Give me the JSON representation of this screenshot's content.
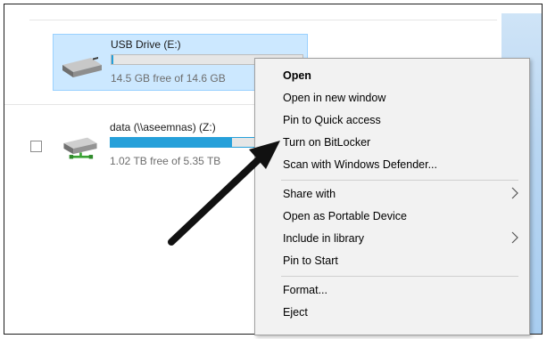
{
  "drives": {
    "usb": {
      "name": "USB Drive (E:)",
      "free_text": "14.5 GB free of 14.6 GB",
      "used_fraction": 0.01
    },
    "network": {
      "name": "data (\\\\aseemnas) (Z:)",
      "free_text": "1.02 TB free of 5.35 TB",
      "used_fraction": 0.81
    }
  },
  "context_menu": {
    "open": "Open",
    "open_new_window": "Open in new window",
    "pin_quick_access": "Pin to Quick access",
    "turn_on_bitlocker": "Turn on BitLocker",
    "scan_defender": "Scan with Windows Defender...",
    "share_with": "Share with",
    "open_portable": "Open as Portable Device",
    "include_library": "Include in library",
    "pin_start": "Pin to Start",
    "format": "Format...",
    "eject": "Eject"
  },
  "colors": {
    "selection": "#cce8ff",
    "bar_fill": "#26a0da",
    "menu_bg": "#f2f2f2"
  },
  "icons": [
    "usb-drive-icon",
    "network-drive-icon",
    "chevron-right-icon",
    "arrow-annotation"
  ]
}
